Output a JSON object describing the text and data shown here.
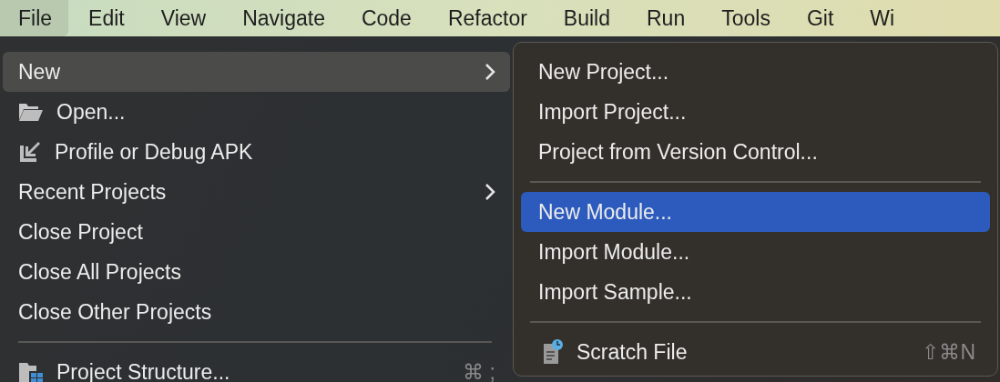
{
  "menu_bar": {
    "items": [
      {
        "label": "File",
        "selected": true
      },
      {
        "label": "Edit",
        "selected": false
      },
      {
        "label": "View",
        "selected": false
      },
      {
        "label": "Navigate",
        "selected": false
      },
      {
        "label": "Code",
        "selected": false
      },
      {
        "label": "Refactor",
        "selected": false
      },
      {
        "label": "Build",
        "selected": false
      },
      {
        "label": "Run",
        "selected": false
      },
      {
        "label": "Tools",
        "selected": false
      },
      {
        "label": "Git",
        "selected": false
      },
      {
        "label": "Wi",
        "selected": false
      }
    ]
  },
  "file_menu": {
    "items": [
      {
        "kind": "item",
        "label": "New",
        "submenu": true,
        "selected": true
      },
      {
        "kind": "folder_item",
        "label": "Open...",
        "selected": false
      },
      {
        "kind": "import_item",
        "label": "Profile or Debug APK",
        "selected": false
      },
      {
        "kind": "item",
        "label": "Recent Projects",
        "submenu": true,
        "selected": false
      },
      {
        "kind": "item",
        "label": "Close Project",
        "selected": false
      },
      {
        "kind": "item",
        "label": "Close All Projects",
        "selected": false
      },
      {
        "kind": "item",
        "label": "Close Other Projects",
        "selected": false
      },
      {
        "kind": "separator"
      },
      {
        "kind": "structure_item",
        "label": "Project Structure...",
        "shortcut": "⌘ ;",
        "selected": false
      }
    ]
  },
  "new_submenu": {
    "items": [
      {
        "kind": "item",
        "label": "New Project...",
        "selected": false
      },
      {
        "kind": "item",
        "label": "Import Project...",
        "selected": false
      },
      {
        "kind": "item",
        "label": "Project from Version Control...",
        "selected": false
      },
      {
        "kind": "separator"
      },
      {
        "kind": "item",
        "label": "New Module...",
        "selected": true
      },
      {
        "kind": "item",
        "label": "Import Module...",
        "selected": false
      },
      {
        "kind": "item",
        "label": "Import Sample...",
        "selected": false
      },
      {
        "kind": "separator"
      },
      {
        "kind": "scratch_item",
        "label": "Scratch File",
        "shortcut": "⇧⌘N",
        "selected": false
      }
    ]
  }
}
